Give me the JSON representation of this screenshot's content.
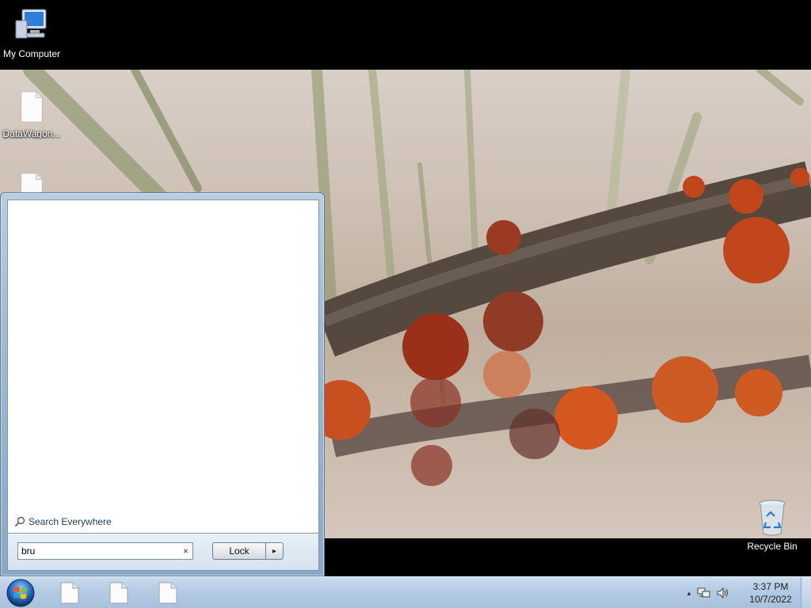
{
  "desktop": {
    "icons": [
      {
        "label": "My Computer",
        "icon": "computer-icon"
      },
      {
        "label": "DataWagon...",
        "icon": "document-icon"
      },
      {
        "label": "",
        "icon": "document-icon"
      },
      {
        "label": "Recycle Bin",
        "icon": "recycle-bin-icon"
      }
    ]
  },
  "start_menu": {
    "search_everywhere_label": "Search Everywhere",
    "search_value": "bru",
    "search_clear_glyph": "×",
    "lock_label": "Lock",
    "lock_arrow_glyph": "▸"
  },
  "taskbar": {
    "start_icon": "windows-orb-icon",
    "pinned": [
      {
        "icon": "document-icon"
      },
      {
        "icon": "document-icon"
      },
      {
        "icon": "document-icon"
      }
    ],
    "tray": {
      "show_hidden_glyph": "▲",
      "icons": [
        "network-icon",
        "volume-icon"
      ]
    },
    "clock": {
      "time": "3:37 PM",
      "date": "10/7/2022"
    }
  },
  "colors": {
    "taskbar_top": "#c9dbee",
    "start_menu_frame": "#9fb9d2",
    "berry": "#c2461c"
  }
}
